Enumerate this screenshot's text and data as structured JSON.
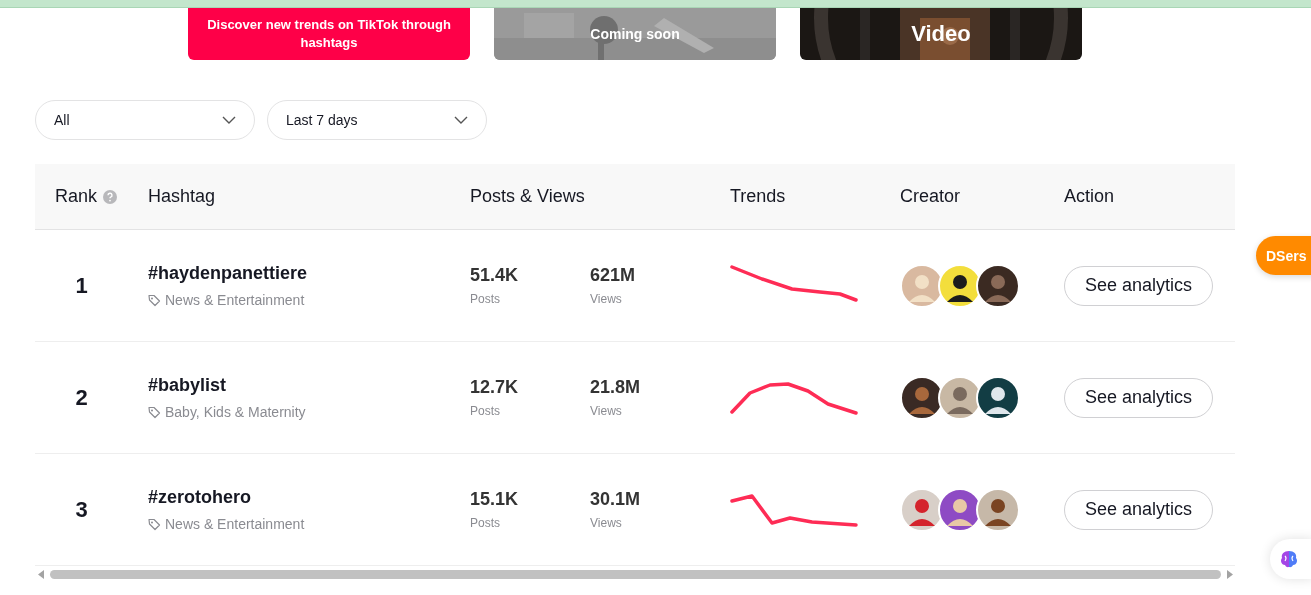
{
  "banner_cards": [
    {
      "kind": "promo",
      "lines": [
        "Discover new trends on TikTok through",
        "hashtags"
      ]
    },
    {
      "kind": "picture",
      "caption": "Coming soon"
    },
    {
      "kind": "picture",
      "caption": "Video"
    }
  ],
  "filters": [
    {
      "value": "All"
    },
    {
      "value": "Last 7 days"
    }
  ],
  "table": {
    "columns": [
      "Rank",
      "Hashtag",
      "Posts & Views",
      "Trends",
      "Creator",
      "Action"
    ],
    "rows": [
      {
        "rank": "1",
        "hashtag": "#haydenpanettiere",
        "category": "News & Entertainment",
        "posts": "51.4K",
        "posts_label": "Posts",
        "views": "621M",
        "views_label": "Views",
        "action": "See analytics"
      },
      {
        "rank": "2",
        "hashtag": "#babylist",
        "category": "Baby, Kids & Maternity",
        "posts": "12.7K",
        "posts_label": "Posts",
        "views": "21.8M",
        "views_label": "Views",
        "action": "See analytics"
      },
      {
        "rank": "3",
        "hashtag": "#zerotohero",
        "category": "News & Entertainment",
        "posts": "15.1K",
        "posts_label": "Posts",
        "views": "30.1M",
        "views_label": "Views",
        "action": "See analytics"
      }
    ]
  },
  "floating_button": "DSers"
}
